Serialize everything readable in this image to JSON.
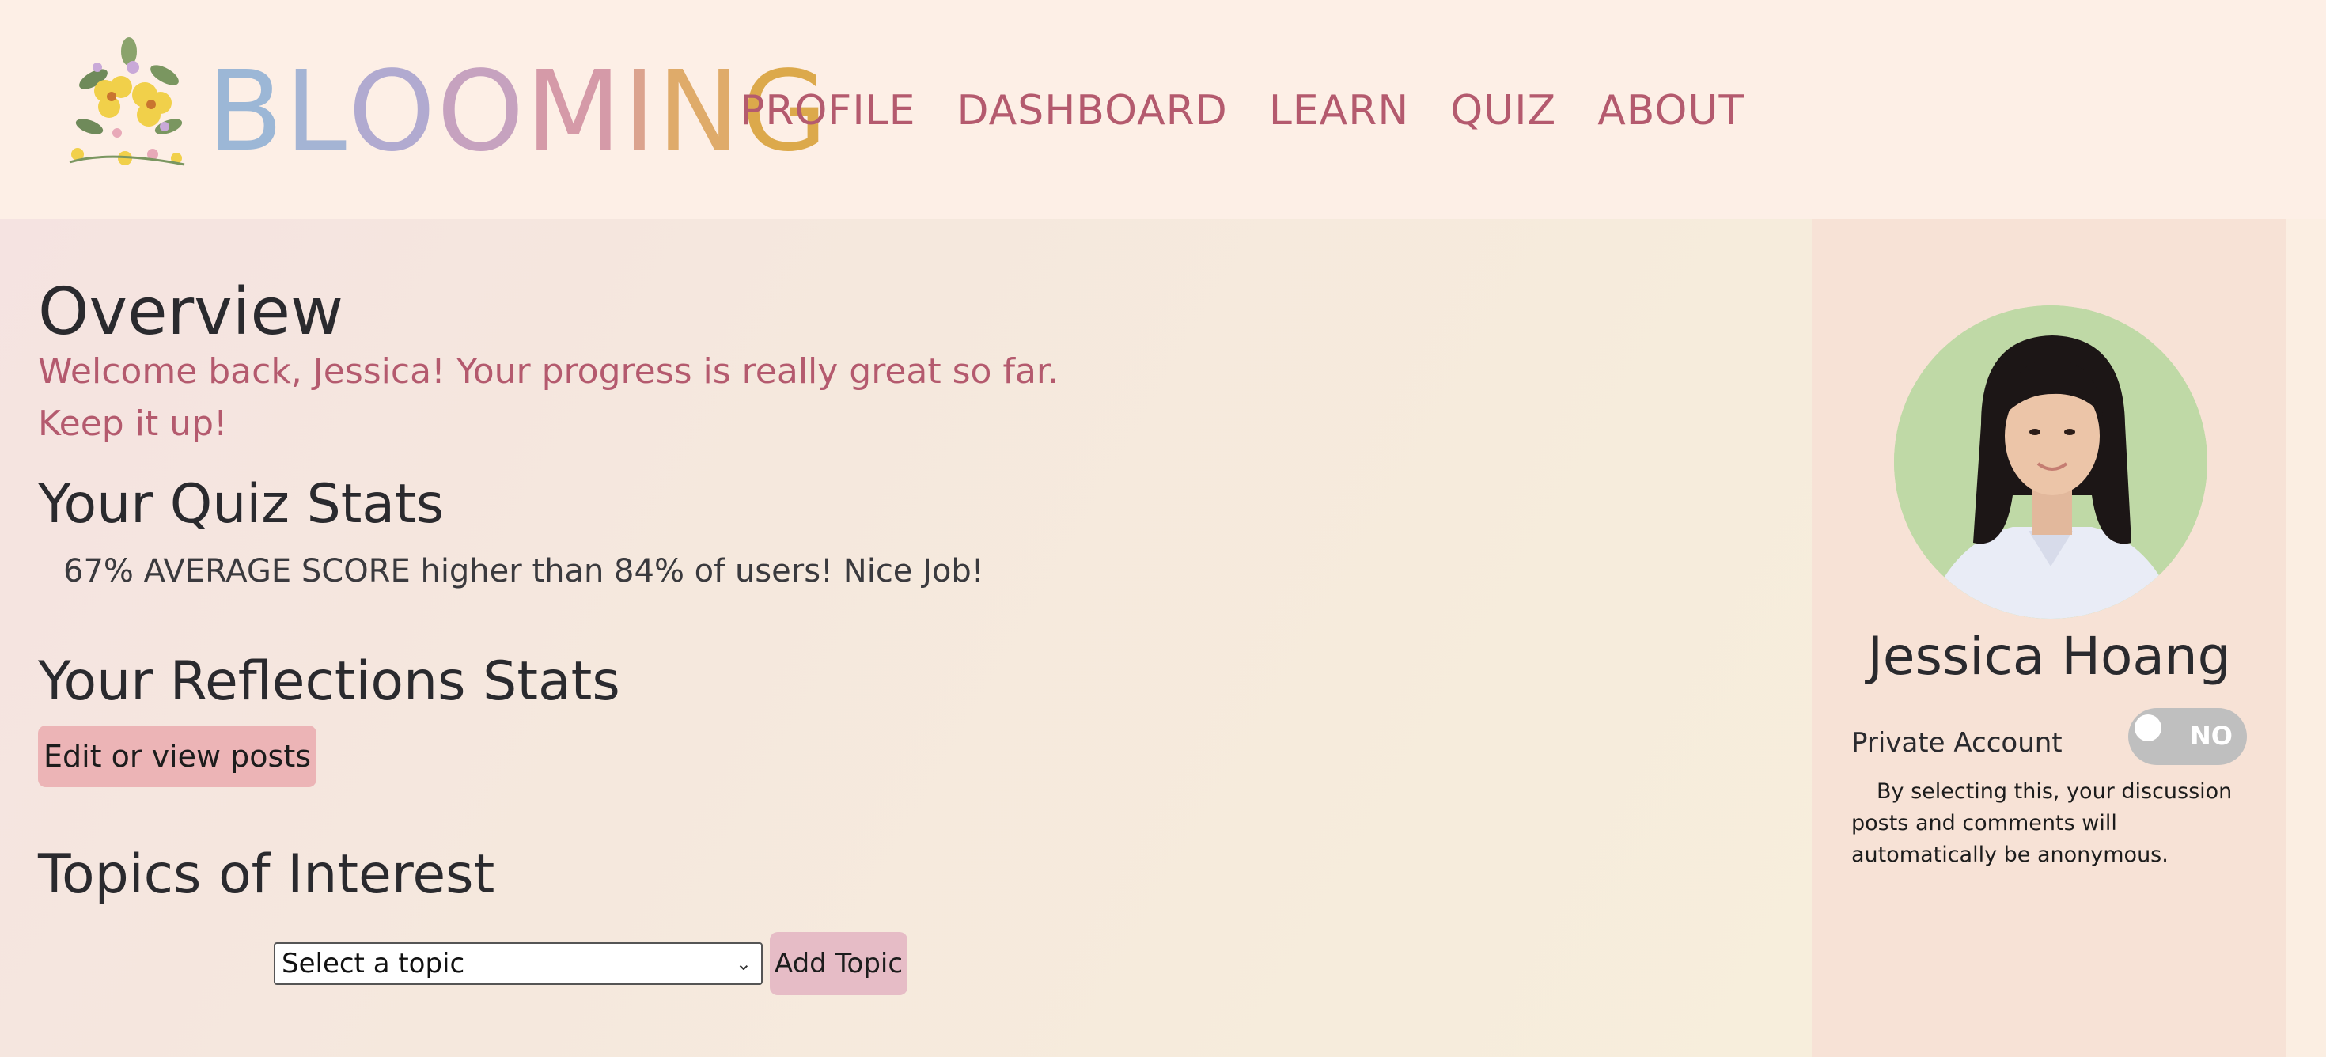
{
  "header": {
    "brand": [
      "B",
      "L",
      "O",
      "O",
      "M",
      "I",
      "N",
      "G"
    ],
    "brand_colors": [
      "#9cb7d6",
      "#a4b4d4",
      "#b1aad0",
      "#c6a2bf",
      "#d59aa8",
      "#dba38e",
      "#dfab6a",
      "#dca94b"
    ],
    "nav": [
      "PROFILE",
      "DASHBOARD",
      "LEARN",
      "QUIZ",
      "ABOUT"
    ]
  },
  "main": {
    "overview_title": "Overview",
    "welcome": "Welcome back, Jessica! Your progress is really great so far. Keep it up!",
    "quiz_title": "Your Quiz Stats",
    "quiz_stat": "67% AVERAGE SCORE higher than 84% of users! Nice Job!",
    "reflections_title": "Your Reflections Stats",
    "edit_button": "Edit or view posts",
    "topics_title": "Topics of Interest",
    "topic_select_value": "Select a topic",
    "add_topic_button": "Add Topic"
  },
  "sidebar": {
    "name": "Jessica Hoang",
    "private_label": "Private Account",
    "toggle_label": "NO",
    "private_note": "By selecting this, your discussion posts and comments will automatically be anonymous."
  },
  "colors": {
    "accent": "#b45a6e",
    "edit_button": "#ecb4b6",
    "add_button": "#e6bcc6"
  }
}
